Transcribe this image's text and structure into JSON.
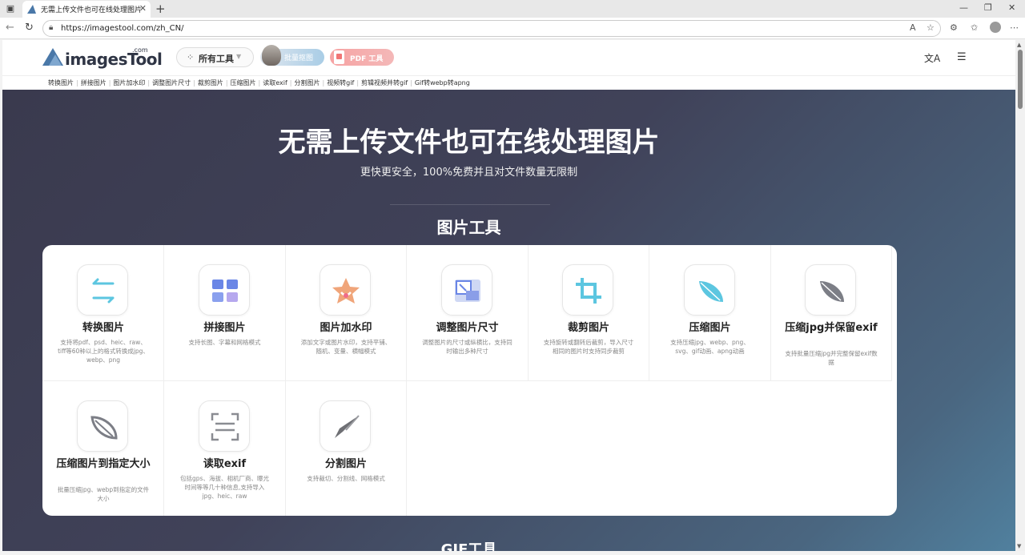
{
  "browser": {
    "tab_title": "无需上传文件也可在线处理图片",
    "url": "https://imagestool.com/zh_CN/"
  },
  "site": {
    "logo_text": "imagesTool",
    "logo_com": ".com",
    "all_tools_label": "所有工具",
    "batch_label": "批量抠图",
    "pdf_label": "PDF 工具"
  },
  "quick_links": [
    "转换图片",
    "拼接图片",
    "图片加水印",
    "调整图片尺寸",
    "裁剪图片",
    "压缩图片",
    "读取exif",
    "分割图片",
    "视频转gif",
    "剪辑视频并转gif",
    "Gif转webp转apng"
  ],
  "hero": {
    "title": "无需上传文件也可在线处理图片",
    "subtitle": "更快更安全，100%免费并且对文件数量无限制",
    "section_title": "图片工具",
    "next_section_title": "GIF工具"
  },
  "tools": [
    {
      "name": "转换图片",
      "desc": "支持将pdf、psd、heic、raw、tiff等60种以上的格式转换成jpg、webp、png",
      "icon": "convert-icon"
    },
    {
      "name": "拼接图片",
      "desc": "支持长图、字幕和网格模式",
      "icon": "collage-icon"
    },
    {
      "name": "图片加水印",
      "desc": "添加文字或图片水印，支持平铺、随机、变量、横幅模式",
      "icon": "watermark-icon"
    },
    {
      "name": "调整图片尺寸",
      "desc": "调整图片的尺寸或纵横比，支持同时输出多种尺寸",
      "icon": "resize-icon"
    },
    {
      "name": "裁剪图片",
      "desc": "支持旋转或翻转后裁剪，导入尺寸相同的图片时支持同步裁剪",
      "icon": "crop-icon"
    },
    {
      "name": "压缩图片",
      "desc": "支持压缩jpg、webp、png、svg、gif动画、apng动画",
      "icon": "compress-icon"
    },
    {
      "name": "压缩jpg并保留exif",
      "desc": "支持批量压缩jpg并完整保留exif数据",
      "icon": "compress-exif-icon"
    },
    {
      "name": "压缩图片到指定大小",
      "desc": "批量压缩jpg、webp到指定的文件大小",
      "icon": "compress-size-icon"
    },
    {
      "name": "读取exif",
      "desc": "包括gps、海拔、相机厂商、曝光时间等等几十种信息,支持导入jpg、heic、raw",
      "icon": "exif-icon"
    },
    {
      "name": "分割图片",
      "desc": "支持裁切、分割线、网格模式",
      "icon": "split-icon"
    }
  ]
}
